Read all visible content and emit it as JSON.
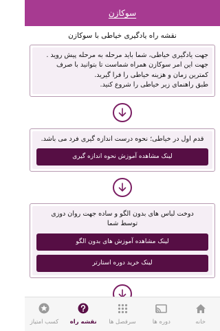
{
  "appbar": {
    "title": "سوکازن"
  },
  "page": {
    "title": "نقشه راه یادگیری خیاطی با سوکازن"
  },
  "intro_card": {
    "lines": [
      "جهت یادگیری خیاطی، شما باید مرحله به مرحله پیش روید .",
      "جهت این امر سوکازن همراه شماست تا بتوانید با صرف",
      "کمترین زمان و هزینه خیاطی را فرا گیرید.",
      "طبق راهنمای زیر خیاطی را شروع کنید."
    ]
  },
  "step1": {
    "text": "قدم اول در خیاطی؛ نحوه درست اندازه گیری فرد می باشد.",
    "button": "لینک مشاهده آموزش نحوه اندازه گیری"
  },
  "step2": {
    "lines": [
      "دوخت لباس های بدون الگو و ساده جهت روان دوزی",
      "توسط شما"
    ],
    "button1": "لینک مشاهده آموزش های بدون الگو",
    "button2": "لینک خرید دوره استارتر"
  },
  "bottom_nav": {
    "items": [
      {
        "label": "خانه",
        "icon": "home-icon"
      },
      {
        "label": "دوره ها",
        "icon": "cast-icon"
      },
      {
        "label": "سرفصل ها",
        "icon": "grid-dots-icon"
      },
      {
        "label": "نقشه راه",
        "icon": "help-circle-icon"
      },
      {
        "label": "کسب امتیاز",
        "icon": "star-icon"
      }
    ],
    "active_index": 3
  },
  "colors": {
    "appbar": "#a73a91",
    "button": "#560e44",
    "card_bg": "#f5eef5",
    "card_border": "#b79ab1",
    "arrow": "#7a1d62",
    "nav_active": "#5a0f47",
    "nav_inactive": "#9a9a9a"
  }
}
